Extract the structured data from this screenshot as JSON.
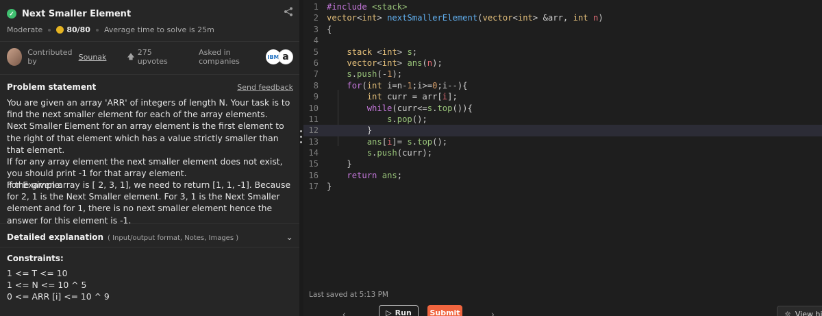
{
  "problem": {
    "title": "Next Smaller Element",
    "difficulty": "Moderate",
    "score": "80/80",
    "avg_time": "Average time to solve is 25m",
    "contributed_label": "Contributed by",
    "contributor": "Sounak",
    "upvotes": "275 upvotes",
    "asked_label": "Asked in companies",
    "company_logos": [
      "IBM",
      "a"
    ],
    "statement_title": "Problem statement",
    "feedback_label": "Send feedback",
    "statement": [
      "You are given an array 'ARR' of integers of length N. Your task is to find the next smaller element for each of the array elements.",
      "Next Smaller Element for an array element is the first element to the right of that element which has a value strictly smaller than that element.",
      "If for any array element the next smaller element does not exist, you should print -1 for that array element.",
      "For Example:"
    ],
    "example": "If the given array is [ 2, 3, 1], we need to return [1, 1, -1]. Because for  2, 1 is the Next Smaller element. For 3, 1 is the Next Smaller element and for 1, there is no next smaller element hence the answer for this element is -1.",
    "detail_title": "Detailed explanation",
    "detail_sub": "( Input/output format, Notes, Images )",
    "constraints_title": "Constraints:",
    "constraints": [
      "1 <= T <= 10",
      "1 <= N <= 10 ^ 5",
      "0 <= ARR [i] <= 10 ^ 9"
    ]
  },
  "editor": {
    "line_numbers": [
      "1",
      "2",
      "3",
      "4",
      "5",
      "6",
      "7",
      "8",
      "9",
      "10",
      "11",
      "12",
      "13",
      "14",
      "15",
      "16",
      "17"
    ],
    "active_line": 12,
    "last_saved": "Last saved at 5:13 PM"
  },
  "actions": {
    "run": "Run",
    "submit": "Submit",
    "hint": "View hint"
  },
  "colors": {
    "submit": "#f0653f",
    "success": "#3fbf6f"
  }
}
